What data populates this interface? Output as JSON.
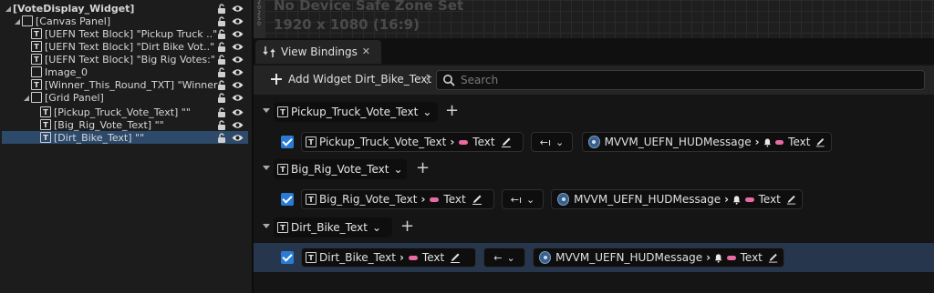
{
  "hierarchy": {
    "items": [
      {
        "label": "[VoteDisplay_Widget]",
        "arrow": "◢",
        "icon": ""
      },
      {
        "label": "[Canvas Panel]",
        "arrow": "◢",
        "icon": "canvas"
      },
      {
        "label": "[UEFN Text Block] \"Pickup Truck ..\"",
        "arrow": "",
        "icon": "T"
      },
      {
        "label": "[UEFN Text Block] \"Dirt Bike Vot..\"",
        "arrow": "",
        "icon": "T"
      },
      {
        "label": "[UEFN Text Block] \"Big Rig Votes:\"",
        "arrow": "",
        "icon": "T"
      },
      {
        "label": "Image_0",
        "arrow": "",
        "icon": "image"
      },
      {
        "label": "[Winner_This_Round_TXT] \"Winner Th",
        "arrow": "",
        "icon": "T"
      },
      {
        "label": "[Grid Panel]",
        "arrow": "◢",
        "icon": "grid"
      },
      {
        "label": "[Pickup_Truck_Vote_Text] \"\"",
        "arrow": "",
        "icon": "T"
      },
      {
        "label": "[Big_Rig_Vote_Text] \"\"",
        "arrow": "",
        "icon": "T"
      },
      {
        "label": "[Dirt_Bike_Text] \"\"",
        "arrow": "",
        "icon": "T"
      }
    ],
    "selected_index": 10
  },
  "designer": {
    "ruler_labels": [
      "2",
      "0",
      "2",
      "5",
      "0"
    ],
    "safe_zone_line1": "No Device Safe Zone Set",
    "safe_zone_line2": "1920 x 1080 (16:9)"
  },
  "tab": {
    "label": "View Bindings",
    "close": "✕"
  },
  "toolbar": {
    "add_label": "Add Widget Dirt_Bike_Text",
    "kebab": "⋮",
    "search_placeholder": "Search"
  },
  "groups": [
    {
      "name": "Pickup_Truck_Vote_Text",
      "binding": {
        "widget": "Pickup_Truck_Vote_Text",
        "widget_prop": "Text",
        "mode": "←ı",
        "viewmodel": "MVVM_UEFN_HUDMessage",
        "vm_prop": "Text"
      }
    },
    {
      "name": "Big_Rig_Vote_Text",
      "binding": {
        "widget": "Big_Rig_Vote_Text",
        "widget_prop": "Text",
        "mode": "←ı",
        "viewmodel": "MVVM_UEFN_HUDMessage",
        "vm_prop": "Text"
      }
    },
    {
      "name": "Dirt_Bike_Text",
      "binding": {
        "widget": "Dirt_Bike_Text",
        "widget_prop": "Text",
        "mode": "←",
        "viewmodel": "MVVM_UEFN_HUDMessage",
        "vm_prop": "Text"
      }
    }
  ],
  "glyphs": {
    "chevron_right": "›",
    "chevron_down": "⌄",
    "text_icon": "T",
    "plus": "+"
  },
  "colors": {
    "accent": "#2a7bd6",
    "selected_row": "#26374d",
    "property_pill": "#e86aa0"
  }
}
